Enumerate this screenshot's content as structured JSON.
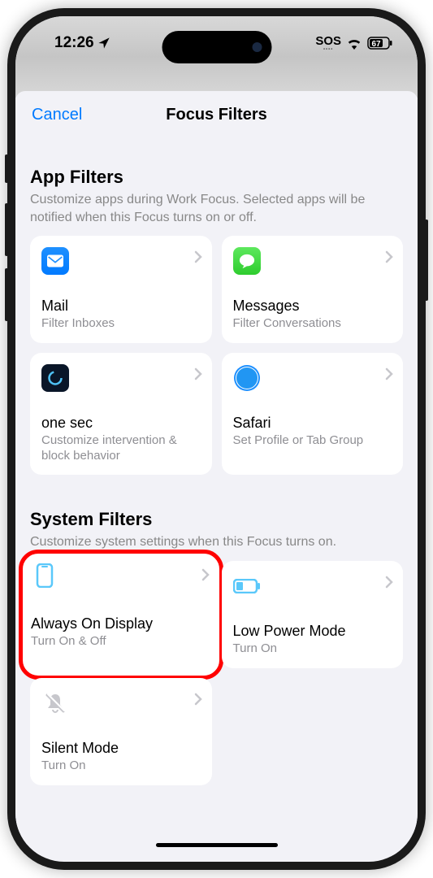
{
  "statusBar": {
    "time": "12:26",
    "sos": "SOS",
    "battery": "67"
  },
  "nav": {
    "cancel": "Cancel",
    "title": "Focus Filters"
  },
  "sections": {
    "app": {
      "title": "App Filters",
      "desc": "Customize apps during Work Focus. Selected apps will be notified when this Focus turns on or off."
    },
    "system": {
      "title": "System Filters",
      "desc": "Customize system settings when this Focus turns on."
    }
  },
  "cards": {
    "mail": {
      "title": "Mail",
      "subtitle": "Filter Inboxes"
    },
    "messages": {
      "title": "Messages",
      "subtitle": "Filter Conversations"
    },
    "onesec": {
      "title": "one sec",
      "subtitle": "Customize intervention & block behavior"
    },
    "safari": {
      "title": "Safari",
      "subtitle": "Set Profile or Tab Group"
    },
    "aod": {
      "title": "Always On Display",
      "subtitle": "Turn On & Off"
    },
    "lpm": {
      "title": "Low Power Mode",
      "subtitle": "Turn On"
    },
    "silent": {
      "title": "Silent Mode",
      "subtitle": "Turn On"
    }
  }
}
